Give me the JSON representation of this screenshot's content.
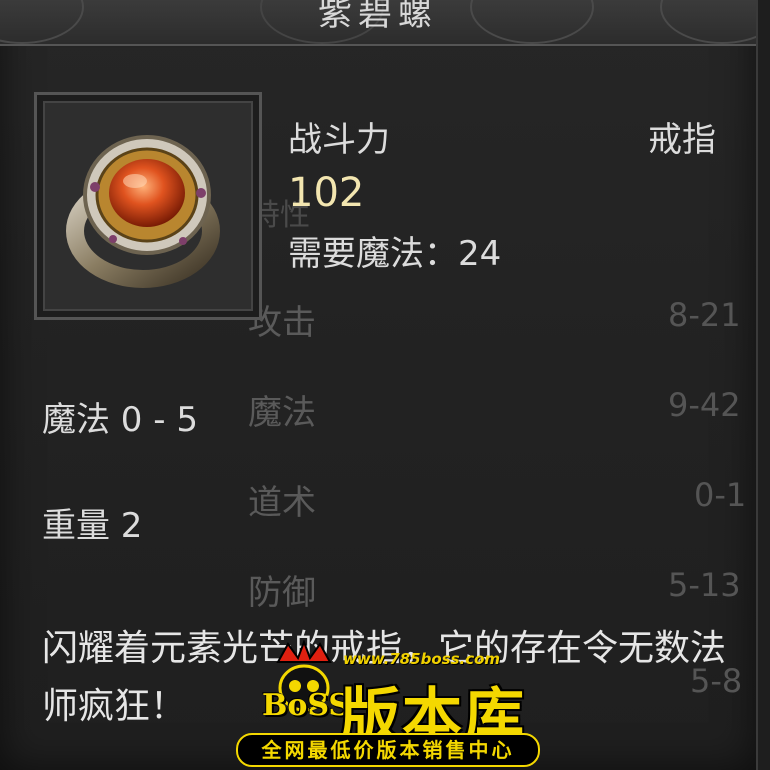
{
  "item": {
    "name": "紫碧螺",
    "slot": "戒指",
    "power_label": "战斗力",
    "power_value": "102",
    "requirement": "需要魔法：24",
    "magic_stat": "魔法 0 - 5",
    "weight": "重量 2",
    "description": "闪耀着元素光芒的戒指，它的存在令无数法师疯狂！",
    "icon": "ring-icon"
  },
  "background_stats": {
    "faded_label": "特性",
    "rows": [
      {
        "label": "攻击",
        "value": "8-21"
      },
      {
        "label": "魔法",
        "value": "9-42"
      },
      {
        "label": "道术",
        "value": "0-1"
      },
      {
        "label": "防御",
        "value": "5-13"
      },
      {
        "label": "",
        "value": "5-8"
      }
    ]
  },
  "watermark": {
    "url": "www.785boss.com",
    "brand": "版本库",
    "boss": "BoSS",
    "tagline": "全网最低价版本销售中心"
  },
  "colors": {
    "power_value": "#f3e6b0",
    "watermark": "#f4d800"
  }
}
